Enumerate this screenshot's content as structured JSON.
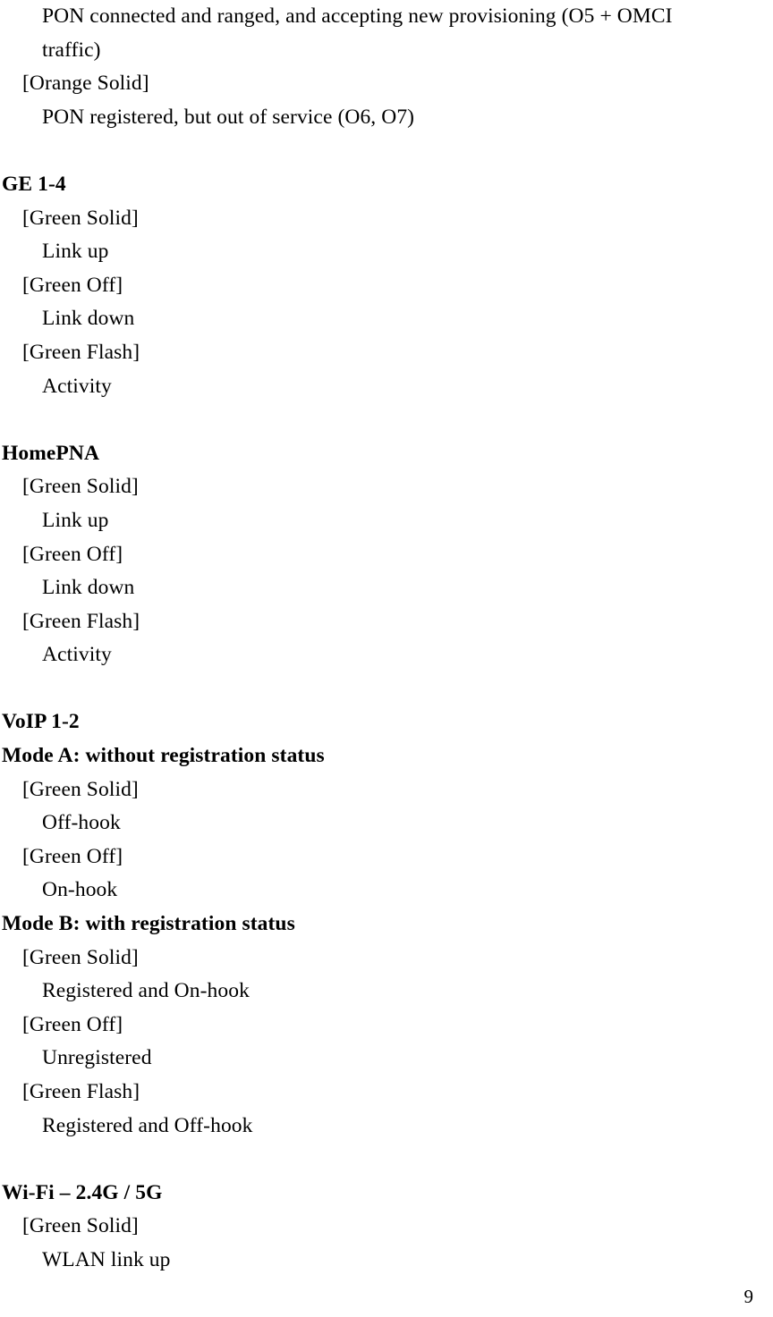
{
  "page": {
    "number": "9"
  },
  "blocks": [
    {
      "type": "wrapped-paragraph",
      "level": 2,
      "style": "body",
      "text": "PON connected and ranged, and accepting new provisioning (O5 + OMCI traffic)"
    },
    {
      "type": "line",
      "level": 1,
      "style": "body",
      "text": "[Orange Solid]"
    },
    {
      "type": "line",
      "level": 2,
      "style": "body",
      "text": "PON registered, but out of service (O6, O7)"
    },
    {
      "type": "spacer"
    },
    {
      "type": "line",
      "level": 0,
      "style": "heading",
      "text": "GE 1-4"
    },
    {
      "type": "line",
      "level": 1,
      "style": "body",
      "text": "[Green Solid]"
    },
    {
      "type": "line",
      "level": 2,
      "style": "body",
      "text": "Link up"
    },
    {
      "type": "line",
      "level": 1,
      "style": "body",
      "text": "[Green Off]"
    },
    {
      "type": "line",
      "level": 2,
      "style": "body",
      "text": "Link down"
    },
    {
      "type": "line",
      "level": 1,
      "style": "body",
      "text": "[Green Flash]"
    },
    {
      "type": "line",
      "level": 2,
      "style": "body",
      "text": "Activity"
    },
    {
      "type": "spacer"
    },
    {
      "type": "line",
      "level": 0,
      "style": "heading",
      "text": "HomePNA"
    },
    {
      "type": "line",
      "level": 1,
      "style": "body",
      "text": "[Green Solid]"
    },
    {
      "type": "line",
      "level": 2,
      "style": "body",
      "text": "Link up"
    },
    {
      "type": "line",
      "level": 1,
      "style": "body",
      "text": "[Green Off]"
    },
    {
      "type": "line",
      "level": 2,
      "style": "body",
      "text": "Link down"
    },
    {
      "type": "line",
      "level": 1,
      "style": "body",
      "text": "[Green Flash]"
    },
    {
      "type": "line",
      "level": 2,
      "style": "body",
      "text": "Activity"
    },
    {
      "type": "spacer"
    },
    {
      "type": "line",
      "level": 0,
      "style": "heading",
      "text": "VoIP 1-2"
    },
    {
      "type": "line",
      "level": 0,
      "style": "heading",
      "text": "Mode A: without registration status"
    },
    {
      "type": "line",
      "level": 1,
      "style": "body",
      "text": "[Green Solid]"
    },
    {
      "type": "line",
      "level": 2,
      "style": "body",
      "text": "Off-hook"
    },
    {
      "type": "line",
      "level": 1,
      "style": "body",
      "text": "[Green Off]"
    },
    {
      "type": "line",
      "level": 2,
      "style": "body",
      "text": "On-hook"
    },
    {
      "type": "line",
      "level": 0,
      "style": "heading",
      "text": "Mode B: with registration status"
    },
    {
      "type": "line",
      "level": 1,
      "style": "body",
      "text": "[Green Solid]"
    },
    {
      "type": "line",
      "level": 2,
      "style": "body",
      "text": "Registered and On-hook"
    },
    {
      "type": "line",
      "level": 1,
      "style": "body",
      "text": "[Green Off]"
    },
    {
      "type": "line",
      "level": 2,
      "style": "body",
      "text": "Unregistered"
    },
    {
      "type": "line",
      "level": 1,
      "style": "body",
      "text": "[Green Flash]"
    },
    {
      "type": "line",
      "level": 2,
      "style": "body",
      "text": "Registered and Off-hook"
    },
    {
      "type": "spacer"
    },
    {
      "type": "line",
      "level": 0,
      "style": "heading",
      "text": "Wi-Fi – 2.4G / 5G"
    },
    {
      "type": "line",
      "level": 1,
      "style": "body",
      "text": "[Green Solid]"
    },
    {
      "type": "line",
      "level": 2,
      "style": "body",
      "text": "WLAN link up"
    }
  ]
}
